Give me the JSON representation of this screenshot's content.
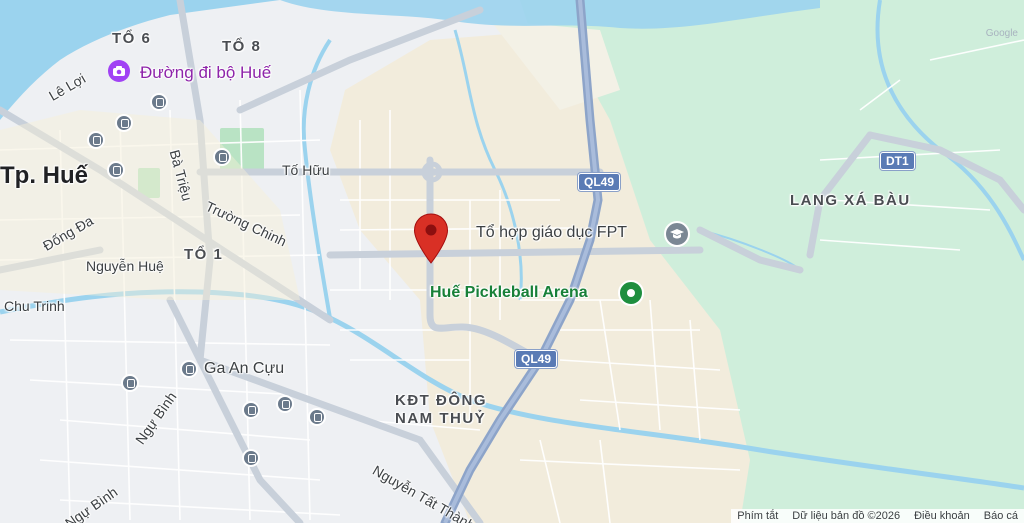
{
  "map": {
    "colors": {
      "water": "#9bd3ee",
      "park": "#c9ecd3",
      "urban": "#f1f0ec",
      "highway": "#8da4c9",
      "major_road": "#c7cfd8",
      "pin": "#d93025"
    },
    "labels": {
      "to6": "TỔ 6",
      "to8": "TỔ 8",
      "to1": "TỔ 1",
      "city": "Tp. Huế",
      "le_loi": "Lê Lợi",
      "ba_trieu": "Bà Triệu",
      "to_huu": "Tố Hữu",
      "truong_chinh": "Trường Chinh",
      "dong_da": "Đống Đa",
      "nguyen_hue": "Nguyễn Huệ",
      "chu_trinh": "Chu Trinh",
      "ngu_binh1": "Ngự Bình",
      "ngu_binh2": "Ngự Bình",
      "nguyen_tat_thanh": "Nguyễn Tất Thành",
      "kdt_line1": "KĐT ĐÔNG",
      "kdt_line2": "NAM THUỶ",
      "lang_xa_bau": "LANG XÁ BÀU"
    },
    "shields": {
      "ql49_top": "QL49",
      "ql49_bottom": "QL49",
      "dt1": "DT1"
    },
    "pois": {
      "walking_street": "Đường đi bộ Huế",
      "fpt": "Tổ hợp giáo dục FPT",
      "pickleball": "Huế Pickleball Arena",
      "station": "Ga An Cựu"
    },
    "icons": {
      "walking_street": "camera-icon",
      "fpt": "school-icon",
      "pickleball": "sports-icon",
      "station": "train-icon",
      "bus": "bus-icon",
      "pin": "map-pin-icon"
    },
    "footer": {
      "shortcuts": "Phím tắt",
      "data": "Dữ liệu bản đồ ©2026",
      "terms": "Điều khoản",
      "report": "Báo cá"
    }
  }
}
